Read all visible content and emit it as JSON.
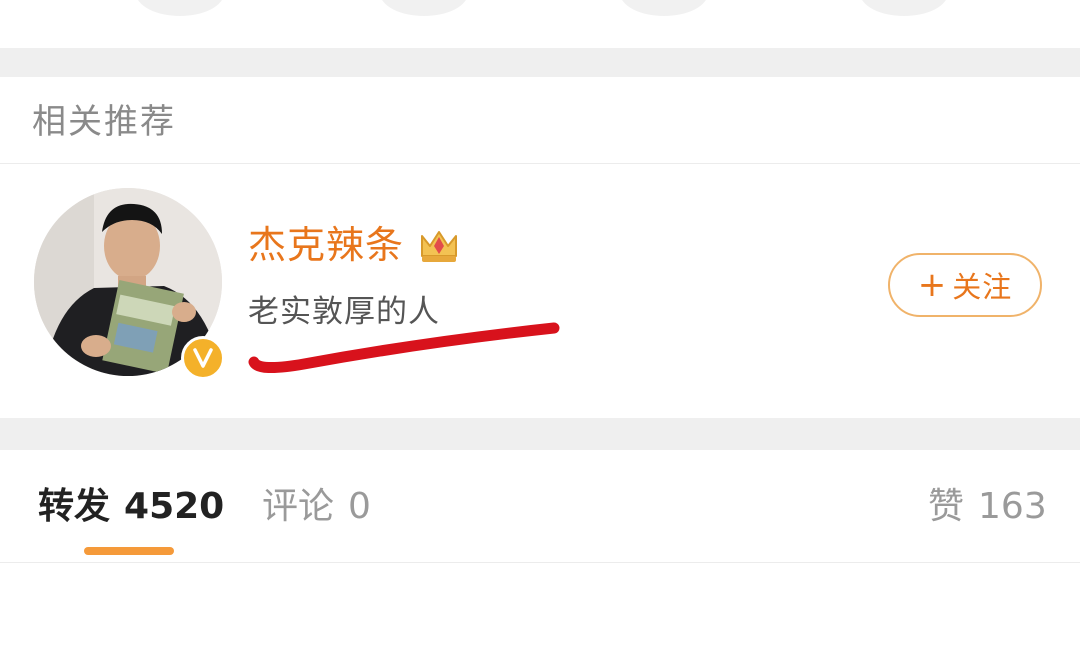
{
  "section": {
    "title": "相关推荐"
  },
  "recommendation": {
    "name": "杰克辣条",
    "description": "老实敦厚的人",
    "verified_mark": "V",
    "follow_label": "关注",
    "follow_plus": "+",
    "crown_icon": "crown-icon",
    "verified_icon": "verified-badge-icon"
  },
  "tabs": [
    {
      "label": "转发",
      "count": "4520",
      "active": true
    },
    {
      "label": "评论",
      "count": "0",
      "active": false
    },
    {
      "label": "赞",
      "count": "163",
      "active": false
    }
  ],
  "colors": {
    "accent": "#e8761c",
    "indicator": "#f59a3a",
    "scribble": "#d8121c",
    "separator": "#efefef",
    "badge": "#f4b12a"
  }
}
